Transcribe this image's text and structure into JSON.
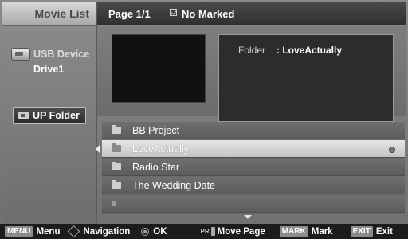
{
  "sidebar": {
    "title": "Movie List",
    "device_label": "USB Device",
    "drive_label": "Drive1",
    "up_folder_label": "UP Folder"
  },
  "header": {
    "page_indicator": "Page 1/1",
    "marked_label": "No Marked"
  },
  "info": {
    "folder_key": "Folder",
    "folder_value": ": LoveActually"
  },
  "file_list": {
    "items": [
      {
        "name": "BB Project",
        "type": "folder",
        "selected": false
      },
      {
        "name": "LoveActually",
        "type": "folder",
        "selected": true
      },
      {
        "name": "Radio Star",
        "type": "folder",
        "selected": false
      },
      {
        "name": "The Wedding Date",
        "type": "folder",
        "selected": false
      },
      {
        "name": "",
        "type": "empty",
        "selected": false
      }
    ]
  },
  "footer": {
    "menu_key": "MENU",
    "menu_label": "Menu",
    "navigation_label": "Navigation",
    "ok_label": "OK",
    "pr_text": "PR",
    "move_page_label": "Move Page",
    "mark_key": "MARK",
    "mark_label": "Mark",
    "exit_key": "EXIT",
    "exit_label": "Exit"
  },
  "colors": {
    "selected_row": "#d6d6d6",
    "background": "#7b7b7b",
    "footer": "#1c1c1c"
  }
}
